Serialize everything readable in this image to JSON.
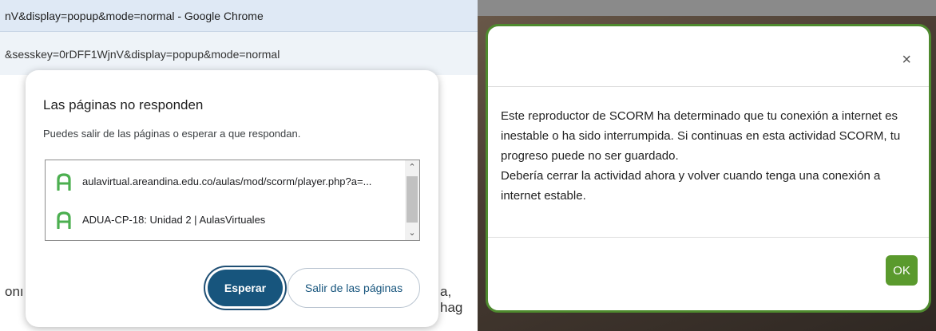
{
  "chrome": {
    "title_bar": "nV&display=popup&mode=normal - Google Chrome",
    "url_fragment": "&sesskey=0rDFF1WjnV&display=popup&mode=normal",
    "background_text_left": "onı",
    "background_text_right": "a, hag"
  },
  "unresponsive_dialog": {
    "title": "Las páginas no responden",
    "message": "Puedes salir de las páginas o esperar a que respondan.",
    "pages": [
      {
        "label": "aulavirtual.areandina.edu.co/aulas/mod/scorm/player.php?a=...",
        "icon": "areandina-favicon-icon"
      },
      {
        "label": "ADUA-CP-18: Unidad 2 | AulasVirtuales",
        "icon": "areandina-favicon-icon"
      }
    ],
    "wait_button": "Esperar",
    "leave_button": "Salir de las páginas"
  },
  "scorm_modal": {
    "close_label": "×",
    "body_paragraph_1": "Este reproductor de SCORM ha determinado que tu conexión a internet es inestable o ha sido interrumpida. Si continuas en esta actividad SCORM, tu progreso puede no ser guardado.",
    "body_paragraph_2": "Debería cerrar la actividad ahora y volver cuando tenga una conexión a internet estable.",
    "ok_button": "OK"
  },
  "colors": {
    "wait_button_bg": "#17557d",
    "modal_border": "#4e8a2e",
    "ok_button_bg": "#5a9a2d",
    "favicon": "#4caf50"
  }
}
